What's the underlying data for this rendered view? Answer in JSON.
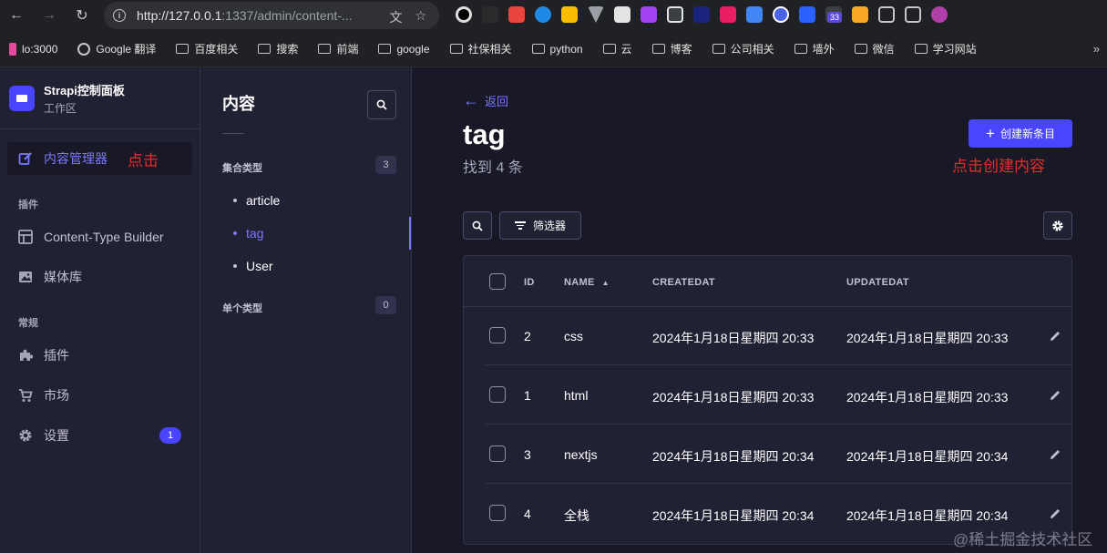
{
  "browser": {
    "url_host": "http://127.0.0.1",
    "url_rest": ":1337/admin/content-...",
    "ext_badge": "33",
    "extension_colors": [
      "#000000",
      "#2b2b2b",
      "#e8453c",
      "#1e88e5",
      "#fbbc04",
      "#9aa0a6",
      "#5f6368",
      "#a142f4",
      "#3c4043",
      "#1a237e",
      "#e91e63",
      "#4285f4",
      "#4a63e7",
      "#2962ff",
      "#f9a825",
      "#e67c73"
    ]
  },
  "bookmarks": [
    {
      "label": "lo:3000",
      "type": "site"
    },
    {
      "label": "Google 翻译",
      "type": "site"
    },
    {
      "label": "百度相关",
      "type": "folder"
    },
    {
      "label": "搜索",
      "type": "folder"
    },
    {
      "label": "前端",
      "type": "folder"
    },
    {
      "label": "google",
      "type": "folder"
    },
    {
      "label": "社保相关",
      "type": "folder"
    },
    {
      "label": "python",
      "type": "folder"
    },
    {
      "label": "云",
      "type": "folder"
    },
    {
      "label": "博客",
      "type": "folder"
    },
    {
      "label": "公司相关",
      "type": "folder"
    },
    {
      "label": "墙外",
      "type": "folder"
    },
    {
      "label": "微信",
      "type": "folder"
    },
    {
      "label": "学习网站",
      "type": "folder"
    }
  ],
  "brand": {
    "title": "Strapi控制面板",
    "subtitle": "工作区",
    "color": "#4945ff"
  },
  "main_nav": {
    "content_manager": "内容管理器",
    "content_manager_annotation": "点击",
    "plugins_section": "插件",
    "content_type_builder": "Content-Type Builder",
    "media_library": "媒体库",
    "general_section": "常规",
    "plugins": "插件",
    "marketplace": "市场",
    "settings": "设置",
    "settings_badge": "1"
  },
  "sub_nav": {
    "title": "内容",
    "collection_types": "集合类型",
    "collection_count": "3",
    "items": [
      "article",
      "tag",
      "User"
    ],
    "single_types": "单个类型",
    "single_count": "0"
  },
  "content": {
    "back": "返回",
    "title": "tag",
    "subtitle": "找到 4 条",
    "create_button": "创建新条目",
    "create_annotation": "点击创建内容",
    "filter_button": "筛选器"
  },
  "table": {
    "headers": {
      "id": "ID",
      "name": "NAME",
      "created": "CREATEDAT",
      "updated": "UPDATEDAT"
    },
    "rows": [
      {
        "id": "2",
        "name": "css",
        "created": "2024年1月18日星期四 20:33",
        "updated": "2024年1月18日星期四 20:33"
      },
      {
        "id": "1",
        "name": "html",
        "created": "2024年1月18日星期四 20:33",
        "updated": "2024年1月18日星期四 20:33"
      },
      {
        "id": "3",
        "name": "nextjs",
        "created": "2024年1月18日星期四 20:34",
        "updated": "2024年1月18日星期四 20:34"
      },
      {
        "id": "4",
        "name": "全栈",
        "created": "2024年1月18日星期四 20:34",
        "updated": "2024年1月18日星期四 20:34"
      }
    ]
  },
  "watermark": "@稀土掘金技术社区",
  "colors": {
    "primary": "#4945ff",
    "active_text": "#7b79ff",
    "annotation_red": "#e0302b",
    "background": "#181826",
    "panel": "#212134"
  }
}
